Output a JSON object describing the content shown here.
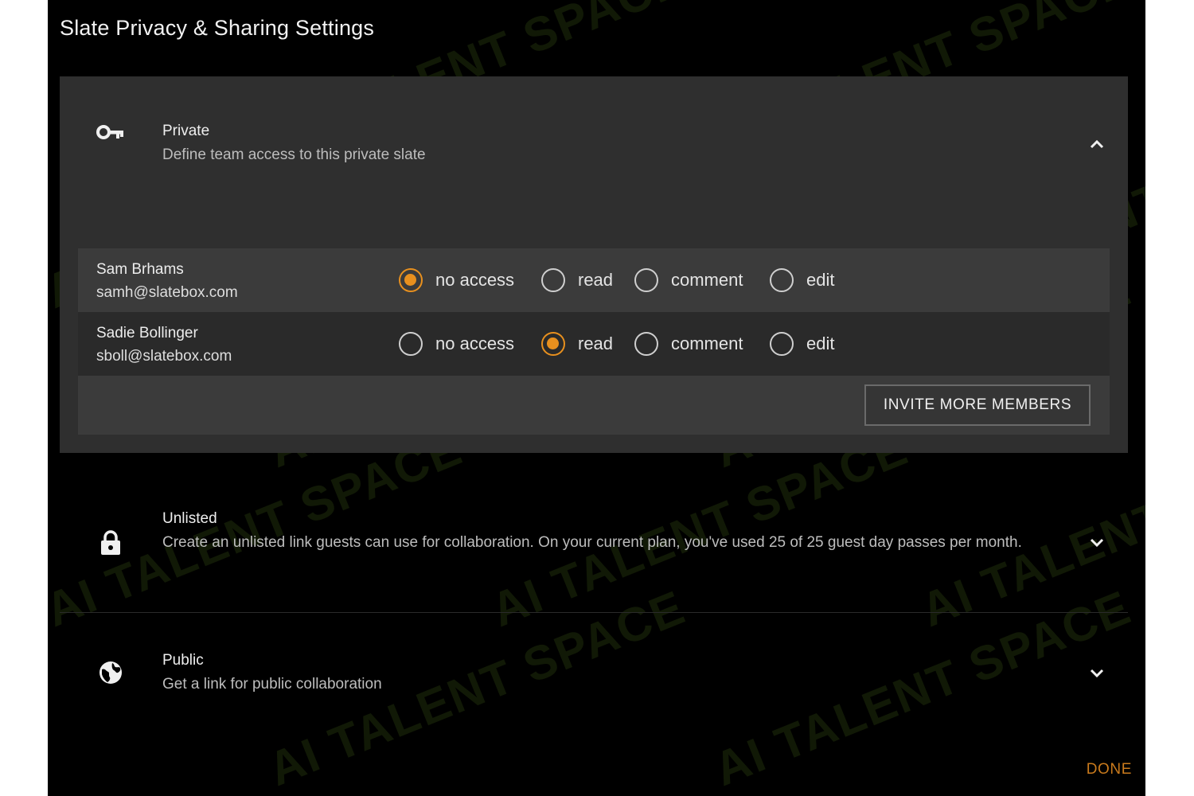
{
  "dialog": {
    "title": "Slate Privacy & Sharing Settings",
    "done_label": "DONE",
    "accent_color": "#e8901e"
  },
  "private": {
    "icon": "key-icon",
    "label": "Private",
    "description": "Define team access to this private slate",
    "expanded": true,
    "invite_label": "INVITE MORE MEMBERS",
    "permission_options": [
      "no access",
      "read",
      "comment",
      "edit"
    ],
    "members": [
      {
        "name": "Sam Brhams",
        "email": "samh@slatebox.com",
        "selected": "no access"
      },
      {
        "name": "Sadie Bollinger",
        "email": "sboll@slatebox.com",
        "selected": "read"
      }
    ]
  },
  "unlisted": {
    "icon": "lock-icon",
    "label": "Unlisted",
    "description": "Create an unlisted link guests can use for collaboration. On your current plan, you've used 25 of 25 guest day passes per month.",
    "expanded": false
  },
  "public": {
    "icon": "globe-icon",
    "label": "Public",
    "description": "Get a link for public collaboration",
    "expanded": false
  },
  "watermark": {
    "text": "AI TALENT SPACE"
  }
}
